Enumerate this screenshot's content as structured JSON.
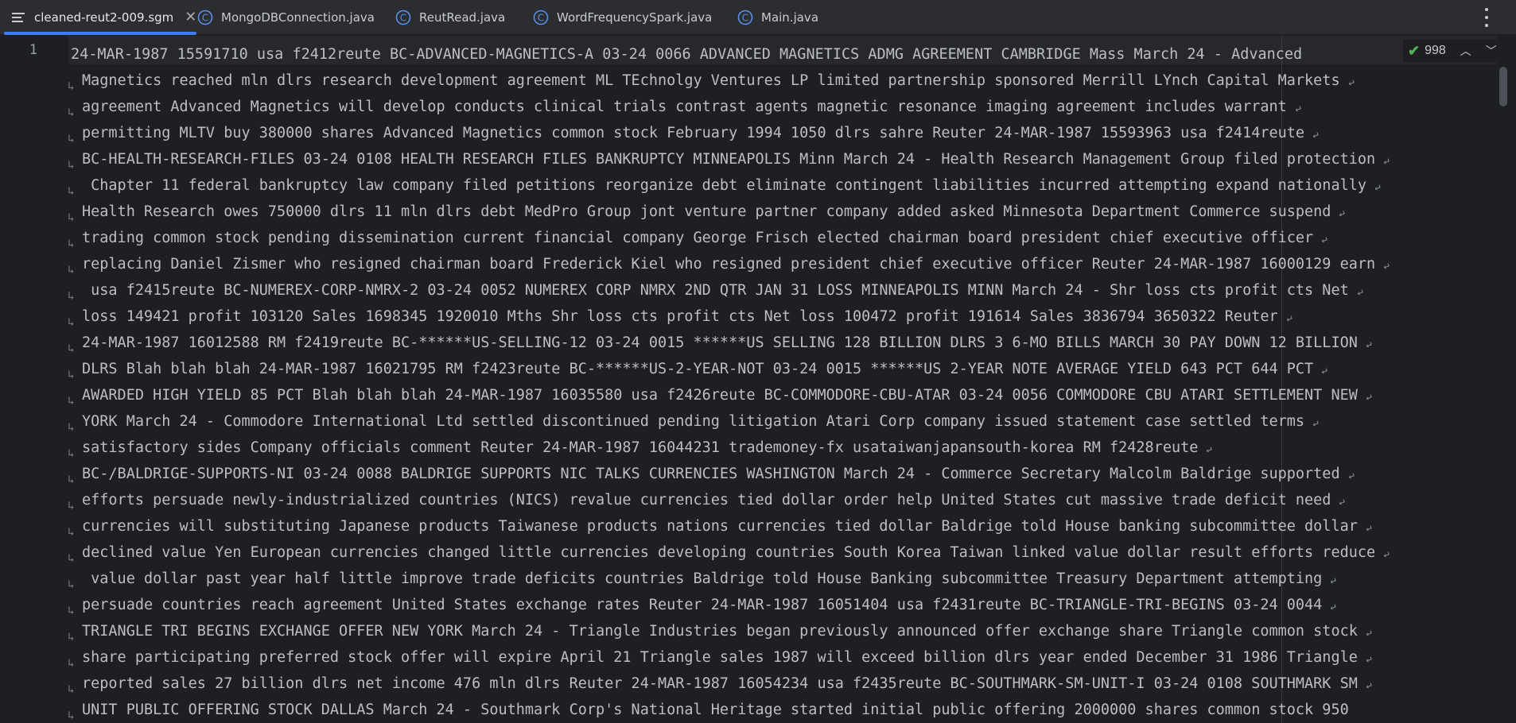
{
  "tabs": [
    {
      "label": "cleaned-reut2-009.sgm",
      "active": true,
      "icon": "list-file-icon",
      "closable": true
    },
    {
      "label": "MongoDBConnection.java",
      "active": false,
      "icon": "java-class-icon"
    },
    {
      "label": "ReutRead.java",
      "active": false,
      "icon": "java-class-icon"
    },
    {
      "label": "WordFrequencySpark.java",
      "active": false,
      "icon": "java-class-icon"
    },
    {
      "label": "Main.java",
      "active": false,
      "icon": "java-class-icon"
    }
  ],
  "inspection": {
    "count": "998"
  },
  "gutter": {
    "line_number": "1"
  },
  "colors": {
    "accent": "#3d7ff2",
    "ok_check": "#4fb35a",
    "background": "#1e1f22",
    "tabbar": "#2b2d30"
  },
  "lines": [
    "24-MAR-1987 15591710 usa f2412reute BC-ADVANCED-MAGNETICS-A 03-24 0066 ADVANCED MAGNETICS ADMG AGREEMENT CAMBRIDGE Mass March 24 - Advanced",
    "Magnetics reached mln dlrs research development agreement ML TEchnolgy Ventures LP limited partnership sponsored Merrill LYnch Capital Markets",
    "agreement Advanced Magnetics will develop conducts clinical trials contrast agents magnetic resonance imaging agreement includes warrant",
    "permitting MLTV buy 380000 shares Advanced Magnetics common stock February 1994 1050 dlrs sahre Reuter 24-MAR-1987 15593963 usa f2414reute",
    "BC-HEALTH-RESEARCH-FILES 03-24 0108 HEALTH RESEARCH FILES BANKRUPTCY MINNEAPOLIS Minn March 24 - Health Research Management Group filed protection",
    " Chapter 11 federal bankruptcy law company filed petitions reorganize debt eliminate contingent liabilities incurred attempting expand nationally",
    "Health Research owes 750000 dlrs 11 mln dlrs debt MedPro Group jont venture partner company added asked Minnesota Department Commerce suspend",
    "trading common stock pending dissemination current financial company George Frisch elected chairman board president chief executive officer",
    "replacing Daniel Zismer who resigned chairman board Frederick Kiel who resigned president chief executive officer Reuter 24-MAR-1987 16000129 earn",
    " usa f2415reute BC-NUMEREX-CORP-NMRX-2 03-24 0052 NUMEREX CORP NMRX 2ND QTR JAN 31 LOSS MINNEAPOLIS MINN March 24 - Shr loss cts profit cts Net",
    "loss 149421 profit 103120 Sales 1698345 1920010 Mths Shr loss cts profit cts Net loss 100472 profit 191614 Sales 3836794 3650322 Reuter",
    "24-MAR-1987 16012588 RM f2419reute BC-******US-SELLING-12 03-24 0015 ******US SELLING 128 BILLION DLRS 3 6-MO BILLS MARCH 30 PAY DOWN 12 BILLION",
    "DLRS Blah blah blah 24-MAR-1987 16021795 RM f2423reute BC-******US-2-YEAR-NOT 03-24 0015 ******US 2-YEAR NOTE AVERAGE YIELD 643 PCT 644 PCT",
    "AWARDED HIGH YIELD 85 PCT Blah blah blah 24-MAR-1987 16035580 usa f2426reute BC-COMMODORE-CBU-ATAR 03-24 0056 COMMODORE CBU ATARI SETTLEMENT NEW",
    "YORK March 24 - Commodore International Ltd settled discontinued pending litigation Atari Corp company issued statement case settled terms",
    "satisfactory sides Company officials comment Reuter 24-MAR-1987 16044231 trademoney-fx usataiwanjapansouth-korea RM f2428reute",
    "BC-/BALDRIGE-SUPPORTS-NI 03-24 0088 BALDRIGE SUPPORTS NIC TALKS CURRENCIES WASHINGTON March 24 - Commerce Secretary Malcolm Baldrige supported",
    "efforts persuade newly-industrialized countries (NICS) revalue currencies tied dollar order help United States cut massive trade deficit need",
    "currencies will substituting Japanese products Taiwanese products nations currencies tied dollar Baldrige told House banking subcommittee dollar",
    "declined value Yen European currencies changed little currencies developing countries South Korea Taiwan linked value dollar result efforts reduce",
    " value dollar past year half little improve trade deficits countries Baldrige told House Banking subcommittee Treasury Department attempting",
    "persuade countries reach agreement United States exchange rates Reuter 24-MAR-1987 16051404 usa f2431reute BC-TRIANGLE-TRI-BEGINS 03-24 0044",
    "TRIANGLE TRI BEGINS EXCHANGE OFFER NEW YORK March 24 - Triangle Industries began previously announced offer exchange share Triangle common stock",
    "share participating preferred stock offer will expire April 21 Triangle sales 1987 will exceed billion dlrs year ended December 31 1986 Triangle",
    "reported sales 27 billion dlrs net income 476 mln dlrs Reuter 24-MAR-1987 16054234 usa f2435reute BC-SOUTHMARK-SM-UNIT-I 03-24 0108 SOUTHMARK SM",
    "UNIT PUBLIC OFFERING STOCK DALLAS March 24 - Southmark Corp's National Heritage started initial public offering 2000000 shares common stock 950"
  ]
}
